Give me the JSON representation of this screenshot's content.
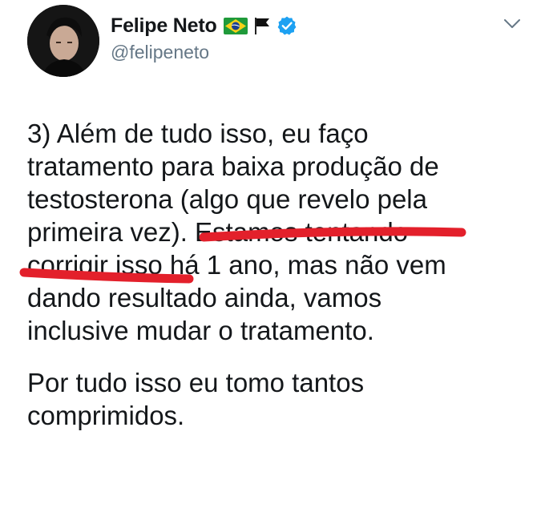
{
  "tweet": {
    "author": {
      "name": "Felipe Neto",
      "handle": "@felipeneto",
      "badges": [
        "brazil-flag",
        "black-flag",
        "verified"
      ]
    },
    "menu_icon": "chevron-down",
    "paragraphs": [
      {
        "lines": [
          "3) Além de tudo isso, eu faço",
          "tratamento para baixa produção de",
          "testosterona (algo que revelo pela",
          "primeira vez). Estamos tentando",
          "corrigir isso há 1 ano, mas não vem",
          "dando resultado ainda, vamos",
          "inclusive mudar o tratamento."
        ]
      },
      {
        "lines": [
          "Por tudo isso eu tomo tantos",
          "comprimidos."
        ]
      }
    ]
  },
  "annotation": {
    "color": "#e3202b",
    "underlined_text": "algo que revelo pela primeira vez"
  }
}
